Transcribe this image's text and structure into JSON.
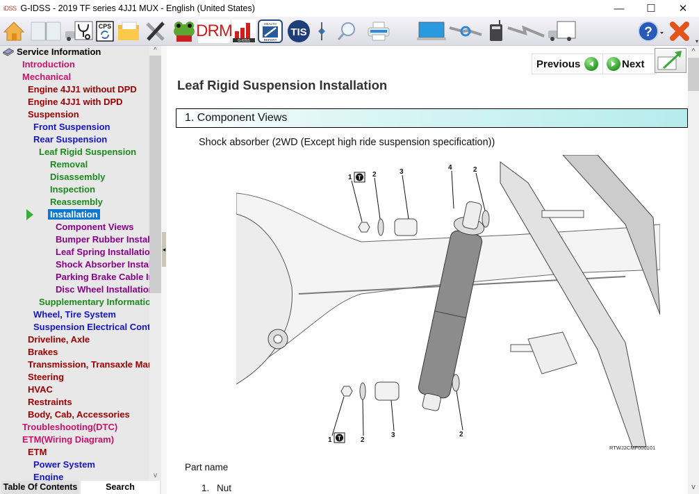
{
  "window": {
    "app_logo": "iDSS",
    "title": "G-IDSS - 2019 TF series 4JJ1 MUX - English (United States)",
    "controls": {
      "minimize": "—",
      "maximize": "☐",
      "close": "✕"
    }
  },
  "toolbar": {
    "buttons": [
      {
        "name": "home",
        "icon": "home-icon"
      },
      {
        "name": "service-manual",
        "icon": "book-icon"
      },
      {
        "name": "diagnostics",
        "icon": "truck-stethoscope-icon"
      },
      {
        "name": "cps",
        "icon": "cps-icon",
        "label": "CPS"
      },
      {
        "name": "open-folder",
        "icon": "folder-icon"
      },
      {
        "name": "tools",
        "icon": "wrench-screwdriver-icon"
      },
      {
        "name": "frog",
        "icon": "frog-icon"
      },
      {
        "name": "drm",
        "icon": "drm-icon",
        "label": "DRM"
      },
      {
        "name": "g-idss-chart",
        "icon": "bar-chart-icon",
        "label": "G-IDSS"
      },
      {
        "name": "health-report",
        "icon": "health-report-icon",
        "label_top": "HEALTH",
        "label_bottom": "REPORT"
      },
      {
        "name": "tis",
        "icon": "tis-icon",
        "label": "TIS"
      },
      {
        "name": "splitter",
        "icon": "splitter-icon"
      },
      {
        "name": "search",
        "icon": "magnifier-icon"
      },
      {
        "name": "print",
        "icon": "printer-icon"
      },
      {
        "name": "laptop",
        "icon": "laptop-icon"
      },
      {
        "name": "sync",
        "icon": "sync-icon"
      },
      {
        "name": "vci-device",
        "icon": "radio-device-icon"
      },
      {
        "name": "connection",
        "icon": "lightning-icon"
      },
      {
        "name": "vehicle",
        "icon": "truck-icon"
      },
      {
        "name": "help",
        "icon": "help-icon",
        "label": "?"
      },
      {
        "name": "exit",
        "icon": "exit-x-icon"
      }
    ],
    "overflow": "▾"
  },
  "sidebar": {
    "root": "Service Information",
    "tree": [
      {
        "label": "Introduction",
        "level": 1,
        "color": "pink"
      },
      {
        "label": "Mechanical",
        "level": 1,
        "color": "pink"
      },
      {
        "label": "Engine 4JJ1 without DPD",
        "level": 2,
        "color": "dred"
      },
      {
        "label": "Engine 4JJ1 with DPD",
        "level": 2,
        "color": "dred"
      },
      {
        "label": "Suspension",
        "level": 2,
        "color": "dred"
      },
      {
        "label": "Front Suspension",
        "level": 3,
        "color": "blue"
      },
      {
        "label": "Rear Suspension",
        "level": 3,
        "color": "blue"
      },
      {
        "label": "Leaf Rigid Suspension",
        "level": 4,
        "color": "green"
      },
      {
        "label": "Removal",
        "level": 5,
        "color": "green"
      },
      {
        "label": "Disassembly",
        "level": 5,
        "color": "green"
      },
      {
        "label": "Inspection",
        "level": 5,
        "color": "green"
      },
      {
        "label": "Reassembly",
        "level": 5,
        "color": "green"
      },
      {
        "label": "Installation",
        "level": 5,
        "color": "green",
        "selected": true
      },
      {
        "label": "Component Views",
        "level": 6,
        "color": "purple"
      },
      {
        "label": "Bumper Rubber Installation",
        "level": 6,
        "color": "purple"
      },
      {
        "label": "Leaf Spring Installation",
        "level": 6,
        "color": "purple"
      },
      {
        "label": "Shock Absorber Installation",
        "level": 6,
        "color": "purple"
      },
      {
        "label": "Parking Brake Cable Installation",
        "level": 6,
        "color": "purple"
      },
      {
        "label": "Disc Wheel Installation",
        "level": 6,
        "color": "purple"
      },
      {
        "label": "Supplementary Information",
        "level": 4,
        "color": "green"
      },
      {
        "label": "Wheel, Tire System",
        "level": 3,
        "color": "blue"
      },
      {
        "label": "Suspension Electrical Controls",
        "level": 3,
        "color": "blue"
      },
      {
        "label": "Driveline, Axle",
        "level": 2,
        "color": "dred"
      },
      {
        "label": "Brakes",
        "level": 2,
        "color": "dred"
      },
      {
        "label": "Transmission, Transaxle Manual",
        "level": 2,
        "color": "dred"
      },
      {
        "label": "Steering",
        "level": 2,
        "color": "dred"
      },
      {
        "label": "HVAC",
        "level": 2,
        "color": "dred"
      },
      {
        "label": "Restraints",
        "level": 2,
        "color": "dred"
      },
      {
        "label": "Body, Cab, Accessories",
        "level": 2,
        "color": "dred"
      },
      {
        "label": "Troubleshooting(DTC)",
        "level": 1,
        "color": "pink"
      },
      {
        "label": "ETM(Wiring Diagram)",
        "level": 1,
        "color": "pink"
      },
      {
        "label": "ETM",
        "level": 2,
        "color": "dred"
      },
      {
        "label": "Power System",
        "level": 3,
        "color": "blue"
      },
      {
        "label": "Engine",
        "level": 3,
        "color": "blue"
      }
    ],
    "tabs": {
      "toc": "Table Of Contents",
      "search": "Search"
    },
    "scroll_up": "^",
    "scroll_down": "v",
    "collapse": "◂"
  },
  "content": {
    "nav": {
      "previous": "Previous",
      "next": "Next"
    },
    "page_title": "Leaf Rigid Suspension Installation",
    "section_header": "1. Component Views",
    "subtitle": "Shock absorber (2WD (Except high ride suspension specification))",
    "figure": {
      "code": "RTWJ2CMF000101",
      "callouts": [
        "1",
        "2",
        "3",
        "4",
        "2",
        "1",
        "2",
        "3",
        "2"
      ],
      "torque_symbol": "T"
    },
    "part_heading": "Part name",
    "parts": [
      {
        "num": "1.",
        "name": "Nut"
      }
    ],
    "scroll_up": "^",
    "scroll_down": "v"
  }
}
